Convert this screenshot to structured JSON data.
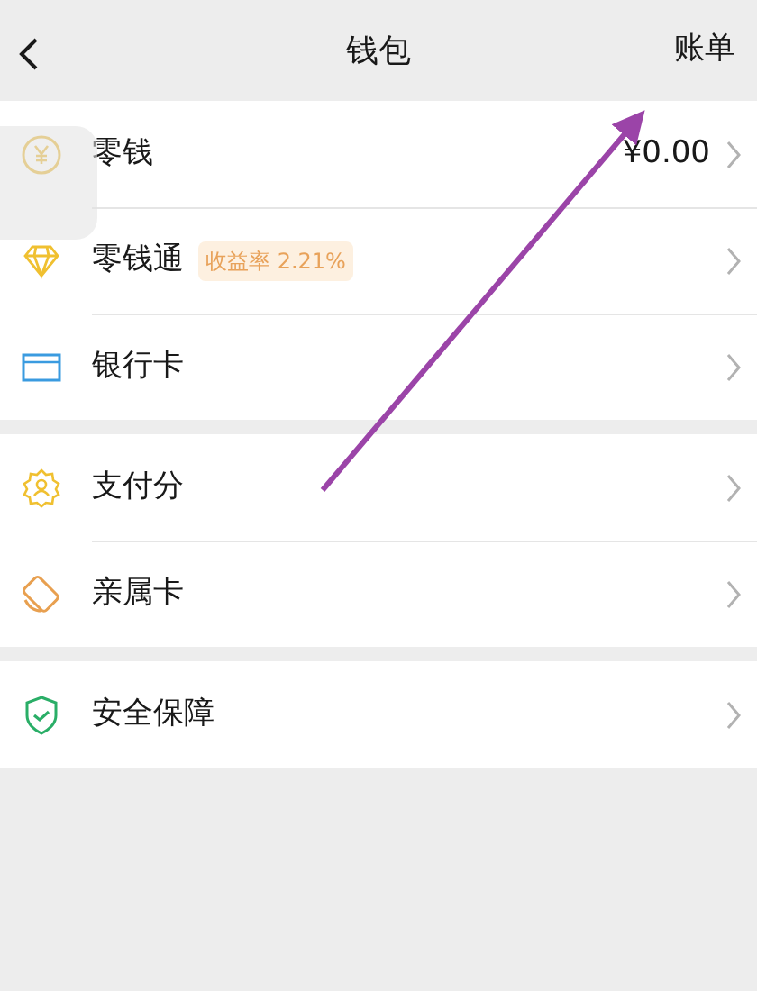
{
  "header": {
    "title": "钱包",
    "action": "账单"
  },
  "groups": [
    {
      "items": [
        {
          "label": "零钱",
          "value": "¥0.00"
        },
        {
          "label": "零钱通",
          "tag": "收益率 2.21%"
        },
        {
          "label": "银行卡"
        }
      ]
    },
    {
      "items": [
        {
          "label": "支付分"
        },
        {
          "label": "亲属卡"
        }
      ]
    },
    {
      "items": [
        {
          "label": "安全保障"
        }
      ]
    }
  ]
}
